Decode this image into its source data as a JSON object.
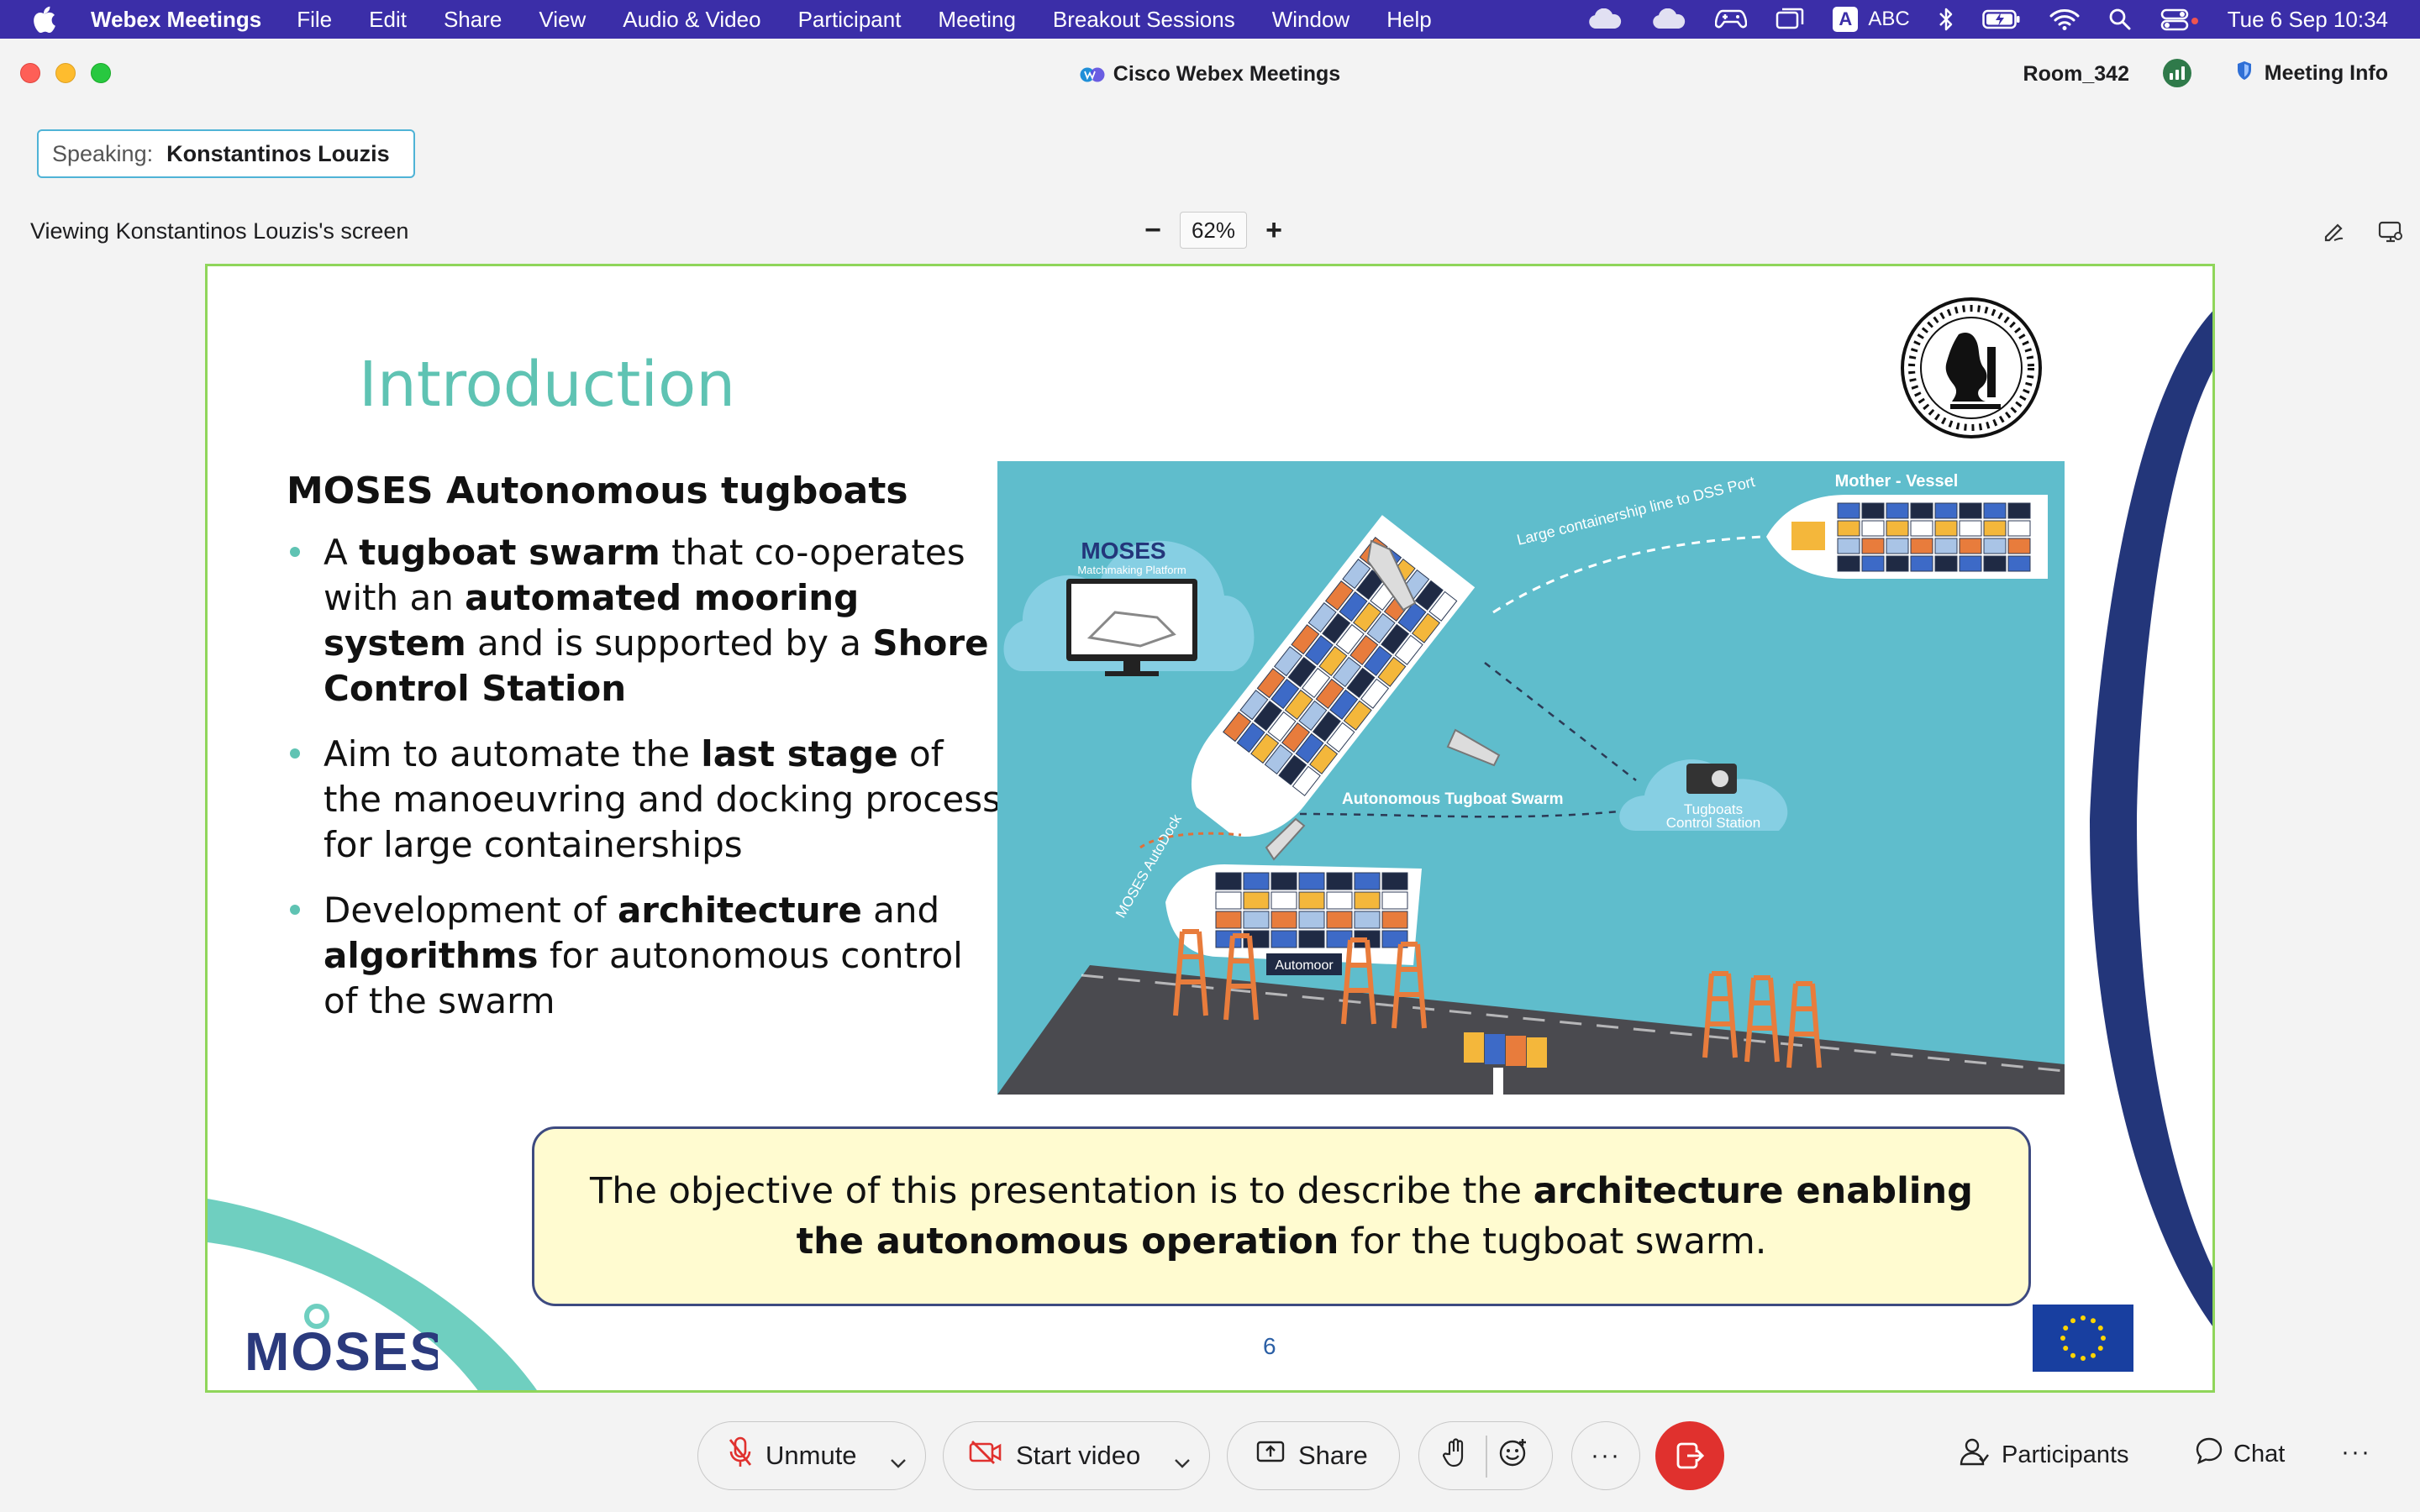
{
  "menubar": {
    "app_name": "Webex Meetings",
    "items": [
      "File",
      "Edit",
      "Share",
      "View",
      "Audio & Video",
      "Participant",
      "Meeting",
      "Breakout Sessions",
      "Window",
      "Help"
    ],
    "input_source": "ABC",
    "input_badge": "A",
    "clock": "Tue 6 Sep  10:34"
  },
  "window": {
    "title": "Cisco Webex Meetings",
    "room": "Room_342",
    "meeting_info": "Meeting Info"
  },
  "speaking": {
    "label": "Speaking:",
    "name": "Konstantinos Louzis"
  },
  "share_toolbar": {
    "viewing": "Viewing Konstantinos Louzis's screen",
    "zoom_out": "−",
    "zoom_level": "62%",
    "zoom_in": "+"
  },
  "slide": {
    "title": "Introduction",
    "subtitle": "MOSES Autonomous tugboats",
    "bullets": [
      [
        "A ",
        "**tugboat swarm**",
        " that co-operates with an ",
        "**automated mooring system**",
        " and is supported by a ",
        "**Shore Control Station**"
      ],
      [
        "Aim to automate the ",
        "**last stage**",
        " of the manoeuvring and docking process for large containerships"
      ],
      [
        "Development of ",
        "**architecture**",
        " and ",
        "**algorithms**",
        " for autonomous control of the swarm"
      ]
    ],
    "objective": [
      "The objective of this presentation is to describe the ",
      "**architecture enabling the autonomous operation**",
      " for the tugboat swarm."
    ],
    "page_number": "6",
    "illustration_labels": {
      "mother_vessel": "Mother - Vessel",
      "containership_line": "Large containership line to DSS Port",
      "moses_platform": "MOSES",
      "matchmaking": "Matchmaking Platform",
      "tugboat_swarm": "Autonomous Tugboat Swarm",
      "control_station_1": "Tugboats",
      "control_station_2": "Control Station",
      "autodock": "MOSES AutoDock",
      "automoor": "Automoor"
    },
    "logo_text": "MOSES"
  },
  "controls": {
    "unmute": "Unmute",
    "start_video": "Start video",
    "share": "Share",
    "more": "···",
    "participants": "Participants",
    "chat": "Chat",
    "overflow": "···"
  },
  "colors": {
    "menubar": "#3b2ea8",
    "slide_title": "#5fc3b3",
    "slide_border": "#8fd55a",
    "end_button": "#e0312e",
    "objective_bg": "#fffbd0",
    "illustration_bg": "#5fbdcc"
  }
}
